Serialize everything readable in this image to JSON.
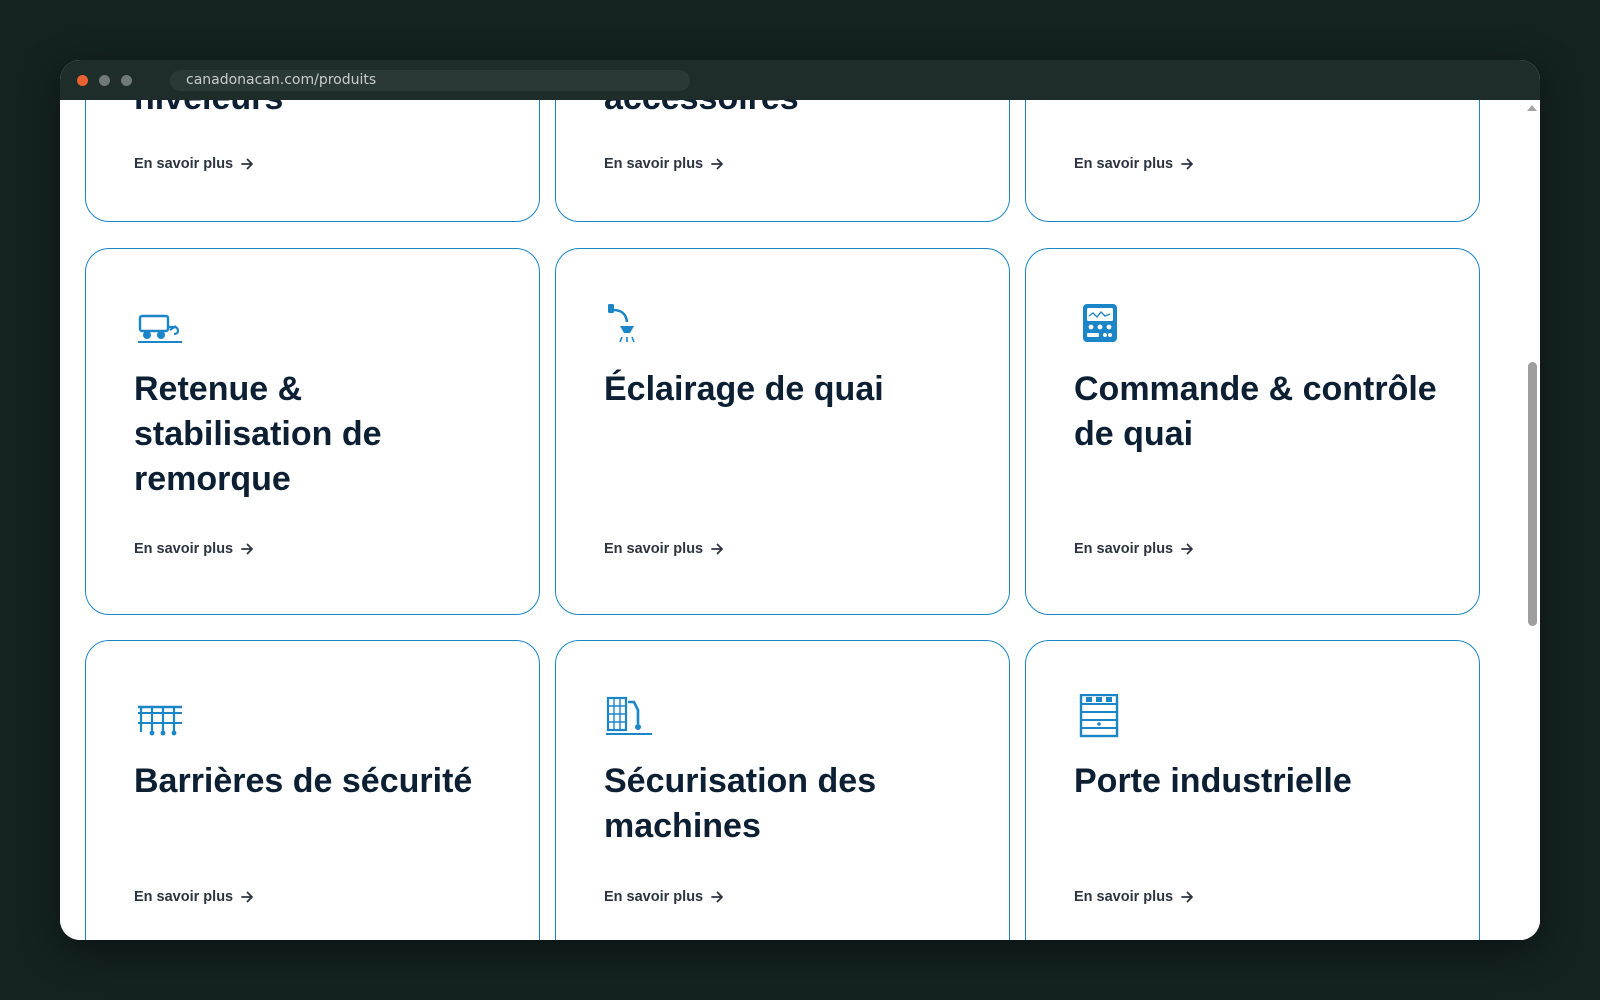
{
  "browser": {
    "url": "canadonacan.com/produits"
  },
  "cards_top": [
    {
      "title_partial": "niveleurs",
      "link": "En savoir plus"
    },
    {
      "title_partial": "accessoires",
      "link": "En savoir plus"
    },
    {
      "title_partial": "",
      "link": "En savoir plus"
    }
  ],
  "cards_middle": [
    {
      "title": "Retenue & stabilisation de remorque",
      "link": "En savoir plus",
      "icon": "trailer-restraint-icon"
    },
    {
      "title": "Éclairage de quai",
      "link": "En savoir plus",
      "icon": "dock-light-icon"
    },
    {
      "title": "Commande & contrôle de quai",
      "link": "En savoir plus",
      "icon": "control-panel-icon"
    }
  ],
  "cards_bottom": [
    {
      "title": "Barrières de sécurité",
      "link": "En savoir plus",
      "icon": "safety-barrier-icon"
    },
    {
      "title": "Sécurisation des machines",
      "link": "En savoir plus",
      "icon": "machine-guarding-icon"
    },
    {
      "title": "Porte industrielle",
      "link": "En savoir plus",
      "icon": "industrial-door-icon"
    }
  ],
  "colors": {
    "accent": "#1b86c7",
    "heading": "#0d1f33",
    "link": "#2c3440"
  }
}
